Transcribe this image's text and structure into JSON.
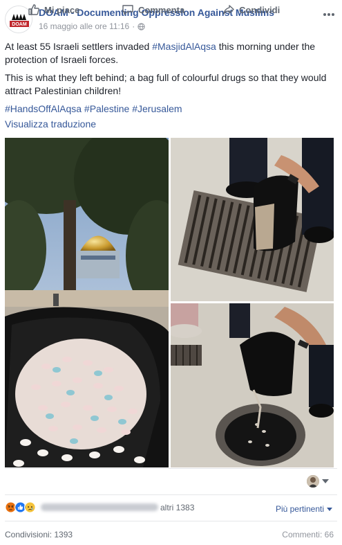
{
  "post": {
    "page_name": "DOAM - Documenting Oppression Against Muslims",
    "avatar_text": "DOAM",
    "timestamp": "16 maggio alle ore 11:16",
    "audience_icon": "globe-icon",
    "more_icon": "ellipsis-icon",
    "text_line1_a": "At least 55 Israeli settlers invaded ",
    "text_line1_link": "#MasjidAlAqsa",
    "text_line1_b": " this morning under the protection of Israeli forces.",
    "text_line2": "This is what they left behind; a bag full of colourful drugs so that they would attract Palestinian children!",
    "hashtags": [
      "#HandsOffAlAqsa",
      "#Palestine",
      "#Jerusalem"
    ],
    "translate_label": "Visualizza traduzione"
  },
  "photos": [
    {
      "name": "dome-of-rock-pills-photo"
    },
    {
      "name": "pouring-pills-drain-photo"
    },
    {
      "name": "emptying-bag-drain-photo"
    }
  ],
  "actions": {
    "like": "Mi piace",
    "comment": "Commenta",
    "share": "Condividi",
    "like_icon": "thumbs-up-icon",
    "comment_icon": "speech-bubble-icon",
    "share_icon": "share-arrow-icon"
  },
  "reactions": {
    "others_text": "altri 1383",
    "relevant_label": "Più pertinenti",
    "colors": {
      "angry": "#e9710f",
      "like": "#2078f4",
      "sad": "#f5c33b"
    }
  },
  "footer": {
    "shares": "Condivisioni: 1393",
    "comments": "Commenti: 66"
  }
}
